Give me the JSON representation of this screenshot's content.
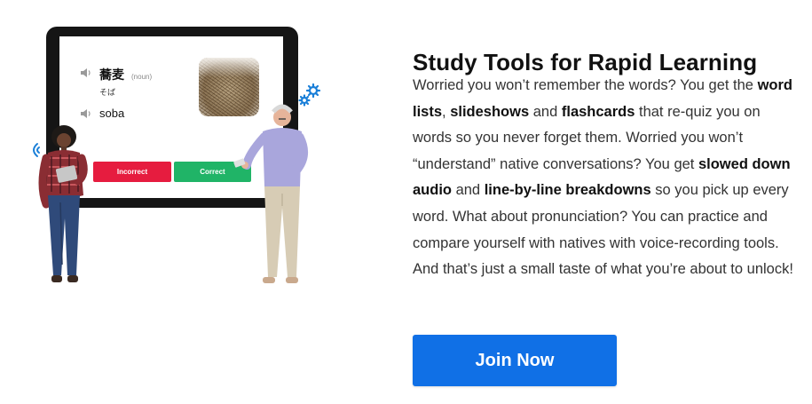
{
  "illustration": {
    "flashcard": {
      "word": "蕎麦",
      "part_of_speech": "(noun)",
      "reading": "そば",
      "romanization": "soba",
      "incorrect_label": "Incorrect",
      "correct_label": "Correct"
    },
    "colors": {
      "incorrect": "#e61c3f",
      "correct": "#20b467",
      "gear": "#1a7fd8"
    }
  },
  "section": {
    "heading": "Study Tools for Rapid Learning",
    "paragraph": {
      "t1": "Worried you won’t remember the words? You get the ",
      "b1": "word lists",
      "t2": ", ",
      "b2": "slideshows",
      "t3": " and ",
      "b3": "flashcards",
      "t4": " that re-quiz you on words so you never forget them. Worried you won’t “understand” native conversations? You get ",
      "b4": "slowed down audio",
      "t5": " and ",
      "b5": "line-by-line breakdowns",
      "t6": " so you pick up every word. What about pronunciation? You can practice and compare yourself with natives with voice-recording tools. And that’s just a small taste of what you’re about to unlock!"
    },
    "cta_label": "Join Now",
    "cta_color": "#1070e6"
  }
}
